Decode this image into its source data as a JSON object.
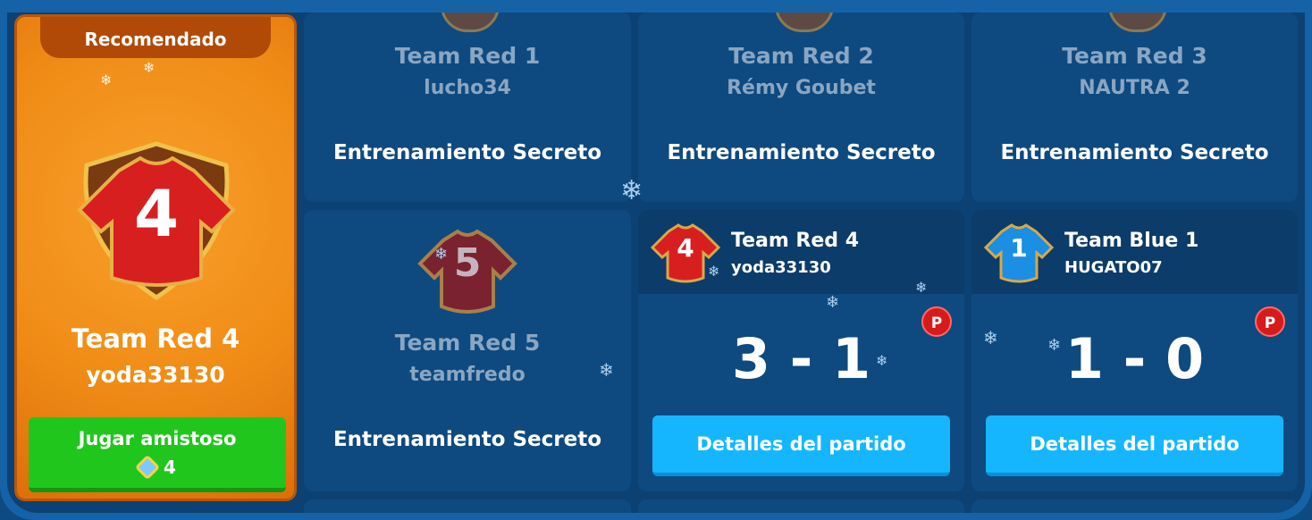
{
  "recommended": {
    "badge": "Recomendado",
    "jersey_number": "4",
    "team": "Team Red 4",
    "user": "yoda33130",
    "play_label": "Jugar amistoso",
    "play_cost": "4"
  },
  "top_row": [
    {
      "team": "Team Red 1",
      "user": "lucho34",
      "status": "Entrenamiento Secreto"
    },
    {
      "team": "Team Red 2",
      "user": "Rémy Goubet",
      "status": "Entrenamiento Secreto"
    },
    {
      "team": "Team Red 3",
      "user": "NAUTRA 2",
      "status": "Entrenamiento Secreto"
    }
  ],
  "secret_card": {
    "jersey_number": "5",
    "team": "Team Red 5",
    "user": "teamfredo",
    "status": "Entrenamiento Secreto"
  },
  "matches": [
    {
      "jersey_number": "4",
      "team": "Team Red 4",
      "user": "yoda33130",
      "score": "3 - 1",
      "badge": "P",
      "button": "Detalles del partido",
      "jersey_color": "#d81f1f"
    },
    {
      "jersey_number": "1",
      "team": "Team Blue 1",
      "user": "HUGATO07",
      "score": "1 - 0",
      "badge": "P",
      "button": "Detalles del partido",
      "jersey_color": "#1a8fe3"
    }
  ],
  "colors": {
    "accent_orange": "#ef8c16",
    "play_green": "#21c61d",
    "details_blue": "#16b6ff",
    "badge_red": "#d71a1a"
  },
  "icons": [
    "gem-icon",
    "snowflake-icon",
    "jersey-icon"
  ]
}
